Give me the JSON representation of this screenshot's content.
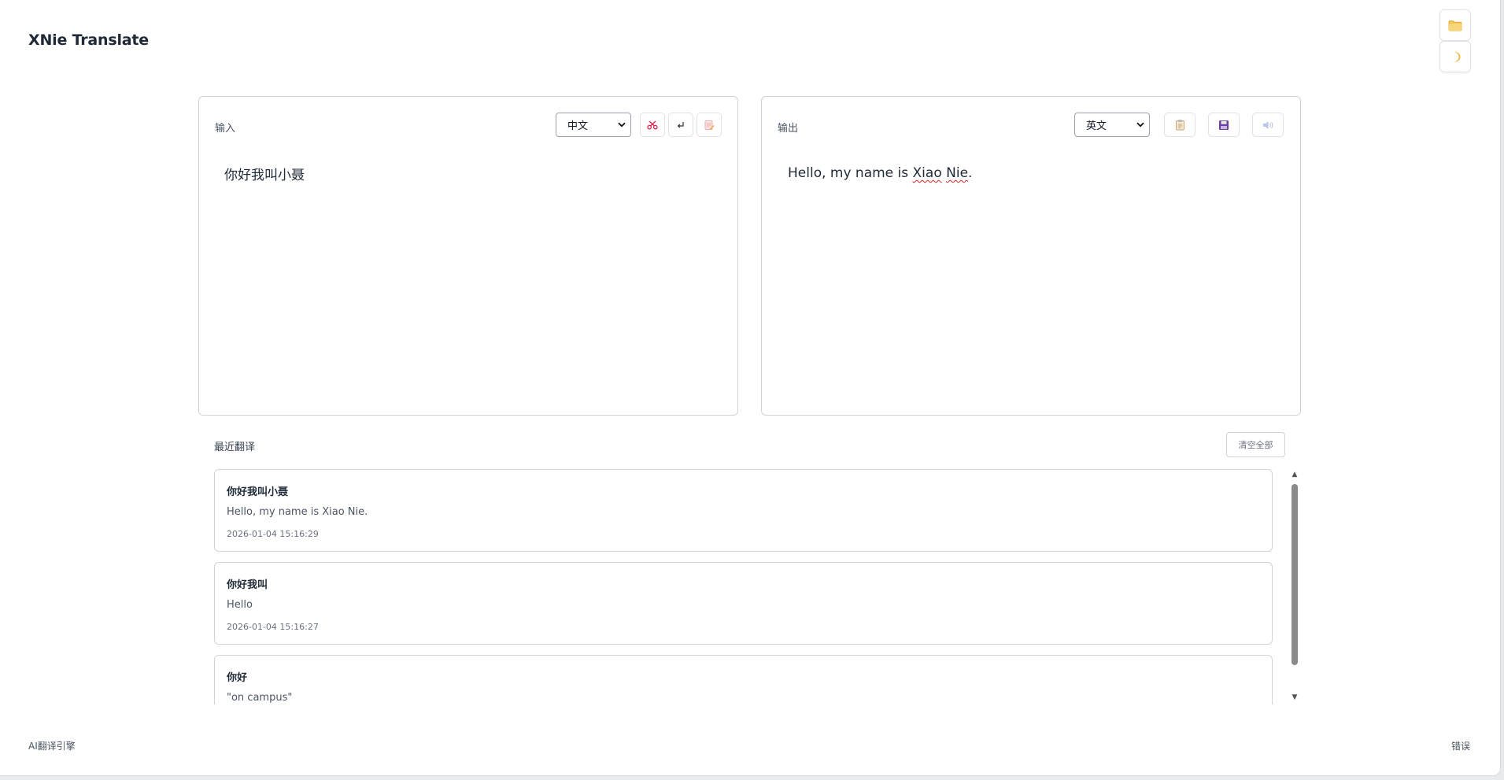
{
  "app": {
    "title": "XNie Translate"
  },
  "corner": {
    "folder_icon": "folder-icon",
    "theme_icon": "moon-icon"
  },
  "input_panel": {
    "label": "输入",
    "language": "中文",
    "text": "你好我叫小聂",
    "tools": [
      "scissors-icon",
      "enter-icon",
      "edit-doc-icon"
    ]
  },
  "output_panel": {
    "label": "输出",
    "language": "英文",
    "text_before": "Hello, my name is ",
    "text_word1": "Xiao",
    "text_space": " ",
    "text_word2": "Nie",
    "text_after": ".",
    "tools": [
      "clipboard-icon",
      "save-icon",
      "speaker-icon"
    ]
  },
  "history": {
    "title": "最近翻译",
    "clear_label": "清空全部",
    "items": [
      {
        "source": "你好我叫小聂",
        "translation": "Hello, my name is Xiao Nie.",
        "time": "2026-01-04 15:16:29"
      },
      {
        "source": "你好我叫",
        "translation": "Hello",
        "time": "2026-01-04 15:16:27"
      },
      {
        "source": "你好",
        "translation": "\"on campus\"",
        "time": ""
      }
    ]
  },
  "footer": {
    "engine": "AI翻译引擎",
    "status": "错误"
  },
  "colors": {
    "accent_red": "#e11d48",
    "folder_yellow": "#f6c453",
    "save_purple": "#6b3fa0"
  }
}
